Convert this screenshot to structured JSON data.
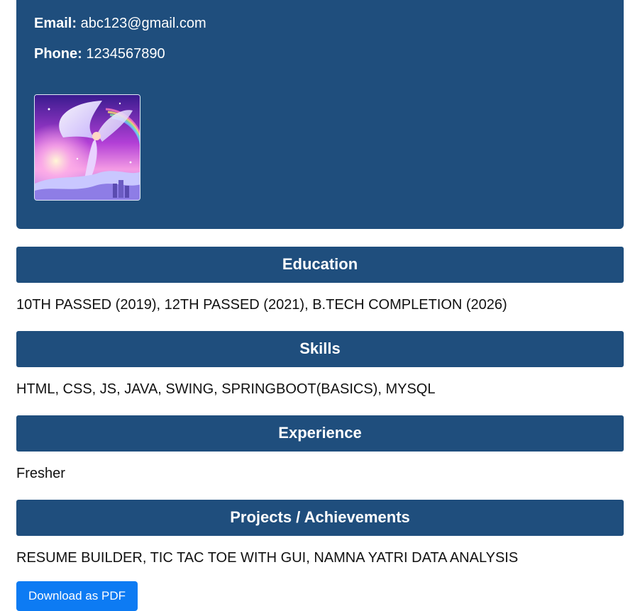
{
  "profile": {
    "email_label": "Email:",
    "email_value": "abc123@gmail.com",
    "phone_label": "Phone:",
    "phone_value": "1234567890",
    "photo_icon": "profile-photo"
  },
  "sections": {
    "education": {
      "title": "Education",
      "text": "10TH PASSED (2019), 12TH PASSED (2021), B.TECH COMPLETION (2026)"
    },
    "skills": {
      "title": "Skills",
      "text": "HTML, CSS, JS, JAVA, SWING, SPRINGBOOT(BASICS), MYSQL"
    },
    "experience": {
      "title": "Experience",
      "text": "Fresher"
    },
    "projects": {
      "title": "Projects / Achievements",
      "text": "RESUME BUILDER, TIC TAC TOE WITH GUI, NAMNA YATRI DATA ANALYSIS"
    }
  },
  "actions": {
    "download_label": "Download as PDF"
  },
  "colors": {
    "header_bg": "#1f4e7d",
    "button_bg": "#0d7bf3",
    "text": "#111111",
    "header_text": "#ffffff"
  }
}
